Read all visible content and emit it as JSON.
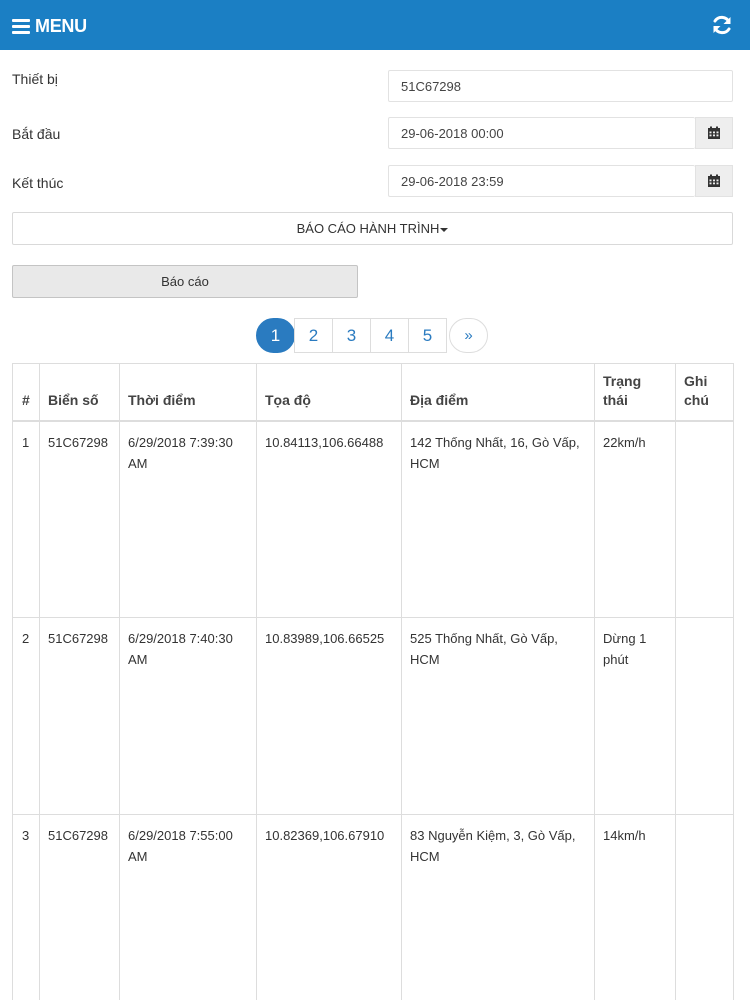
{
  "header": {
    "menu_label": "MENU",
    "menu_icon": "bars-icon",
    "refresh_icon": "refresh-icon"
  },
  "form": {
    "device_label": "Thiết bị",
    "device_value": "51C67298",
    "start_label": "Bắt đầu",
    "start_value": "29-06-2018 00:00",
    "end_label": "Kết thúc",
    "end_value": "29-06-2018 23:59",
    "calendar_icon": "calendar-icon"
  },
  "report_type": {
    "label": "BÁO CÁO HÀNH TRÌNH"
  },
  "report_button": {
    "label": "Báo cáo"
  },
  "pagination": {
    "pages": [
      "1",
      "2",
      "3",
      "4",
      "5"
    ],
    "active_page": "1",
    "next_label": "»"
  },
  "table": {
    "headers": [
      "#",
      "Biển số",
      "Thời điểm",
      "Tọa độ",
      "Địa điểm",
      "Trạng thái",
      "Ghi chú"
    ],
    "rows": [
      [
        "1",
        "51C67298",
        "6/29/2018 7:39:30 AM",
        "10.84113,106.66488",
        "142 Thống Nhất, 16, Gò Vấp, HCM",
        "22km/h",
        ""
      ],
      [
        "2",
        "51C67298",
        "6/29/2018 7:40:30 AM",
        "10.83989,106.66525",
        "525 Thống Nhất, Gò Vấp, HCM",
        "Dừng 1 phút",
        ""
      ],
      [
        "3",
        "51C67298",
        "6/29/2018 7:55:00 AM",
        "10.82369,106.67910",
        "83 Nguyễn Kiệm, 3, Gò Vấp, HCM",
        "14km/h",
        ""
      ]
    ]
  },
  "colors": {
    "navbar": "#1b7fc4",
    "accent": "#2a7bc0"
  }
}
